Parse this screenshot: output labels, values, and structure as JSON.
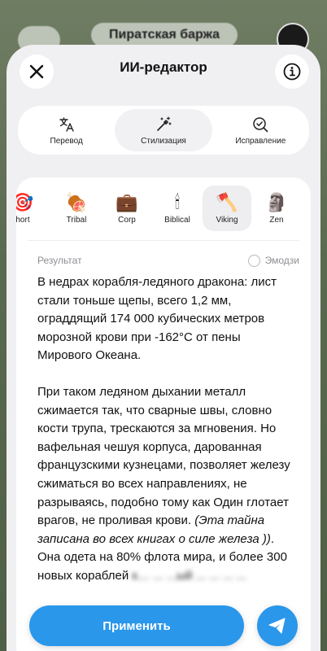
{
  "background": {
    "chat_title": "Пиратская баржа"
  },
  "header": {
    "title": "ИИ-редактор",
    "close_icon": "close-icon",
    "info_icon": "info-icon"
  },
  "tools": [
    {
      "label": "Перевод",
      "icon": "translate-icon"
    },
    {
      "label": "Стилизация",
      "icon": "magic-wand-icon"
    },
    {
      "label": "Исправление",
      "icon": "check-magnifier-icon"
    }
  ],
  "styles": [
    {
      "label": "hort",
      "emoji": "🎯"
    },
    {
      "label": "Tribal",
      "emoji": "🍖"
    },
    {
      "label": "Corp",
      "emoji": "💼"
    },
    {
      "label": "Biblical",
      "emoji": "🕯"
    },
    {
      "label": "Viking",
      "emoji": "🪓"
    },
    {
      "label": "Zen",
      "emoji": "🗿"
    }
  ],
  "result": {
    "label": "Результат",
    "emoji_toggle": "Эмодзи",
    "paragraph1": "В недрах корабля-ледяного дракона: лист стали тоньше щепы, всего 1,2 мм, ограддящий 174 000 кубических метров морозной крови при -162°C от пены Мирового Океана.",
    "paragraph2_plain": "При таком ледяном дыхании металл сжимается так, что сварные швы, словно кости трупа, трескаются за мгновения. Но вафельная чешуя корпуса, дарованная французскими кузнецами, позволяет железу сжиматься во всех направлениях, не разрываясь, подобно тому как Один глотает врагов, не проливая крови.",
    "paragraph2_italic": "(Эта тайна записана во всех книгах о силе железа ))",
    "paragraph2_tail": ". Она одета на 80% флота мира, и более 300 новых кораблей",
    "blurred_tail": "к… ... ...ый ... ... ... ..."
  },
  "actions": {
    "apply_label": "Применить",
    "send_icon": "send-icon"
  },
  "colors": {
    "accent": "#2a97eb",
    "sheet_bg": "#f0f0f3"
  }
}
